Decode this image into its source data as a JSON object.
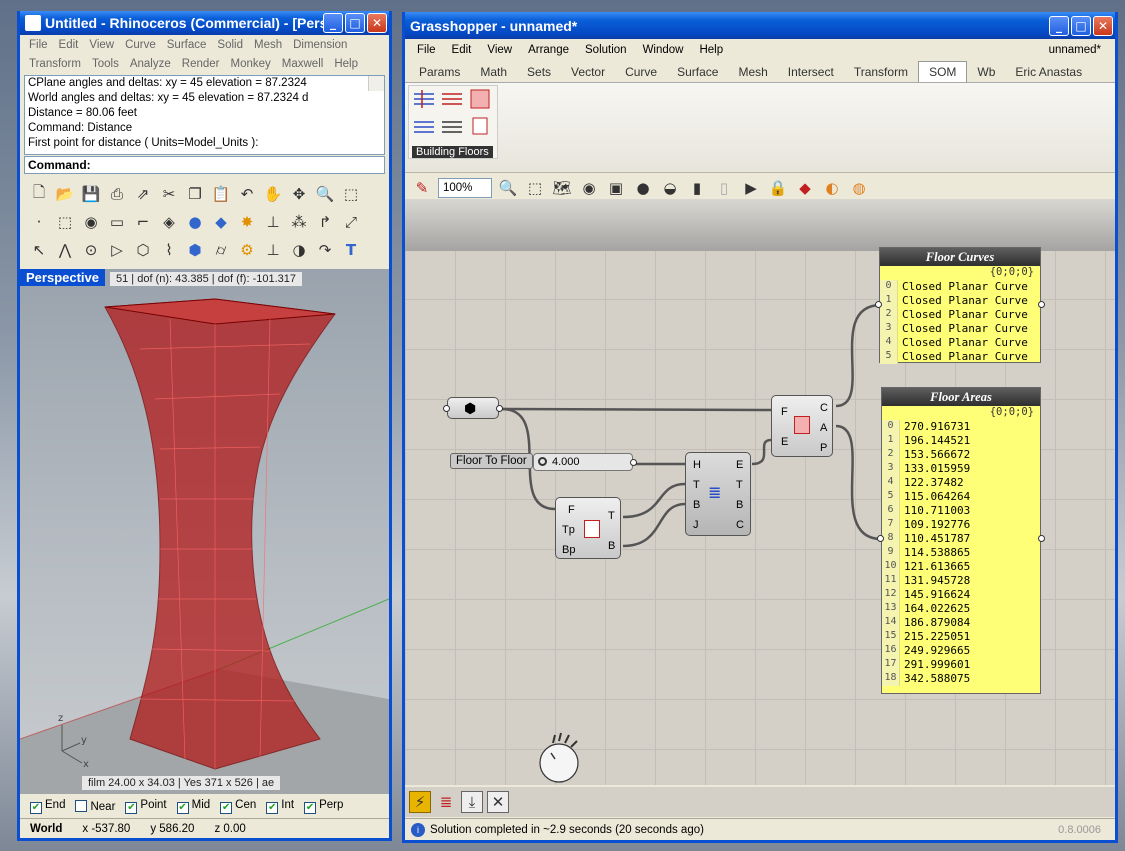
{
  "rhino": {
    "title": "Untitled - Rhinoceros (Commercial) - [Pers...",
    "menu_row1": [
      "File",
      "Edit",
      "View",
      "Curve",
      "Surface",
      "Solid",
      "Mesh",
      "Dimension"
    ],
    "menu_row2": [
      "Transform",
      "Tools",
      "Analyze",
      "Render",
      "Monkey",
      "Maxwell",
      "Help"
    ],
    "history": [
      "CPlane angles and deltas:           xy = 45  elevation = 87.2324",
      "World angles and deltas:  xy = 45  elevation = 87.2324          d",
      "Distance = 80.06 feet",
      "Command: Distance",
      "First point for distance ( Units=Model_Units ):"
    ],
    "command_label": "Command:",
    "viewport_label": "Perspective",
    "viewport_info": "51  |  dof (n): 43.385  |  dof (f): -101.317",
    "viewport_film": "film 24.00 x 34.03  |  Yes 371 x 526  |  ae",
    "osnaps": [
      {
        "label": "End",
        "checked": true
      },
      {
        "label": "Near",
        "checked": false
      },
      {
        "label": "Point",
        "checked": true
      },
      {
        "label": "Mid",
        "checked": true
      },
      {
        "label": "Cen",
        "checked": true
      },
      {
        "label": "Int",
        "checked": true
      },
      {
        "label": "Perp",
        "checked": true
      }
    ],
    "status": {
      "cplane": "World",
      "x": "x -537.80",
      "y": "y 586.20",
      "z": "z 0.00"
    }
  },
  "gh": {
    "title": "Grasshopper - unnamed*",
    "menu": [
      "File",
      "Edit",
      "View",
      "Arrange",
      "Solution",
      "Window",
      "Help"
    ],
    "doc_name": "unnamed*",
    "tabs": [
      "Params",
      "Math",
      "Sets",
      "Vector",
      "Curve",
      "Surface",
      "Mesh",
      "Intersect",
      "Transform",
      "SOM",
      "Wb",
      "Eric Anastas"
    ],
    "active_tab": "SOM",
    "ribbon_group_label": "Building Floors",
    "zoom": "100%",
    "floor_curves": {
      "title": "Floor Curves",
      "path": "{0;0;0}",
      "rows": [
        "Closed Planar Curve",
        "Closed Planar Curve",
        "Closed Planar Curve",
        "Closed Planar Curve",
        "Closed Planar Curve",
        "Closed Planar Curve"
      ]
    },
    "floor_areas": {
      "title": "Floor Areas",
      "path": "{0;0;0}",
      "rows": [
        "270.916731",
        "196.144521",
        "153.566672",
        "133.015959",
        "122.37482",
        "115.064264",
        "110.711003",
        "109.192776",
        "110.451787",
        "114.538865",
        "121.613665",
        "131.945728",
        "145.916624",
        "164.022625",
        "186.879084",
        "215.225051",
        "249.929665",
        "291.999601",
        "342.588075"
      ]
    },
    "slider_label": "Floor To Floor",
    "slider_value": "4.000",
    "comp_tower": {
      "inputs": [
        "F",
        "Tp",
        "Bp"
      ],
      "outputs": [
        "T",
        "B"
      ]
    },
    "comp_floors": {
      "inputs": [
        "H",
        "T",
        "B",
        "J"
      ],
      "outputs": [
        "E",
        "T",
        "B",
        "C"
      ]
    },
    "comp_area": {
      "inputs": [
        "F",
        "E"
      ],
      "outputs": [
        "C",
        "A",
        "P"
      ]
    },
    "status_text": "Solution completed in ~2.9 seconds (20 seconds ago)",
    "version": "0.8.0006"
  }
}
